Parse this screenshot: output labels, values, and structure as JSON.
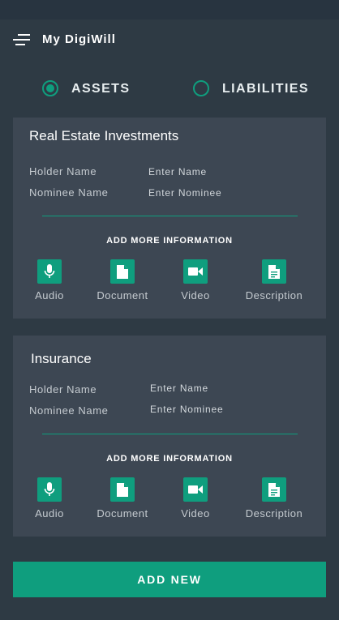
{
  "header": {
    "title": "My DigiWill",
    "menu_icon": "menu-icon"
  },
  "tabs": [
    {
      "label": "ASSETS",
      "selected": true
    },
    {
      "label": "LIABILITIES",
      "selected": false
    }
  ],
  "cards": [
    {
      "title": "Real Estate Investments",
      "holder_label": "Holder Name",
      "holder_value": "Enter Name",
      "nominee_label": "Nominee Name",
      "nominee_value": "Enter Nominee",
      "more_info": "ADD MORE INFORMATION",
      "media": [
        "Audio",
        "Document",
        "Video",
        "Description"
      ]
    },
    {
      "title": "Insurance",
      "holder_label": "Holder Name",
      "holder_value": "Enter Name",
      "nominee_label": "Nominee Name",
      "nominee_value": "Enter Nominee",
      "more_info": "ADD MORE INFORMATION",
      "media": [
        "Audio",
        "Document",
        "Video",
        "Description"
      ]
    }
  ],
  "add_new_label": "ADD NEW",
  "colors": {
    "accent": "#0f9e7e",
    "background": "#2e3a44",
    "card": "#3d4753"
  }
}
